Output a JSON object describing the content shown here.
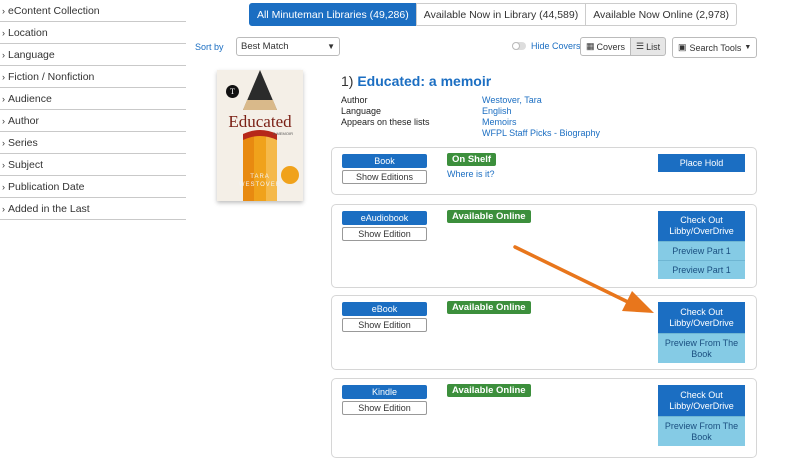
{
  "sidebar": {
    "facets": [
      "eContent Collection",
      "Location",
      "Language",
      "Fiction / Nonfiction",
      "Audience",
      "Author",
      "Series",
      "Subject",
      "Publication Date",
      "Added in the Last"
    ]
  },
  "tabs": [
    {
      "label": "All Minuteman Libraries (49,286)",
      "active": true
    },
    {
      "label": "Available Now in Library (44,589)",
      "active": false
    },
    {
      "label": "Available Now Online (2,978)",
      "active": false
    }
  ],
  "toolbar": {
    "sort_label": "Sort by",
    "sort_value": "Best Match",
    "hide_covers": "Hide Covers",
    "covers": "Covers",
    "list": "List",
    "search_tools": "Search Tools"
  },
  "cover": {
    "title": "Educated",
    "subtitle": "A MEMOIR",
    "author_first": "TARA",
    "author_last": "WESTOVER",
    "nyt": "T"
  },
  "result": {
    "number": "1)",
    "title": "Educated: a memoir",
    "meta": [
      {
        "label": "Author",
        "value": "Westover, Tara"
      },
      {
        "label": "Language",
        "value": "English"
      },
      {
        "label": "Appears on these lists",
        "values": [
          "Memoirs",
          "WFPL Staff Picks - Biography"
        ]
      }
    ]
  },
  "formats": [
    {
      "format": "Book",
      "editions": "Show Editions",
      "status": "On Shelf",
      "where": "Where is it?",
      "action": "Place Hold"
    },
    {
      "format": "eAudiobook",
      "editions": "Show Edition",
      "status": "Available Online",
      "action": "Check Out Libby/OverDrive",
      "previews": [
        "Preview Part 1",
        "Preview Part 1"
      ]
    },
    {
      "format": "eBook",
      "editions": "Show Edition",
      "status": "Available Online",
      "action": "Check Out Libby/OverDrive",
      "previews": [
        "Preview From The Book"
      ]
    },
    {
      "format": "Kindle",
      "editions": "Show Edition",
      "status": "Available Online",
      "action": "Check Out Libby/OverDrive",
      "previews": [
        "Preview From The Book"
      ]
    }
  ],
  "colors": {
    "primary": "#1b6ec2",
    "available": "#3c8f3c",
    "preview": "#85cbe5",
    "arrow": "#e8761c"
  },
  "icons": [
    "chevron-right-icon",
    "caret-down-icon",
    "grid-icon",
    "list-icon",
    "briefcase-icon"
  ]
}
